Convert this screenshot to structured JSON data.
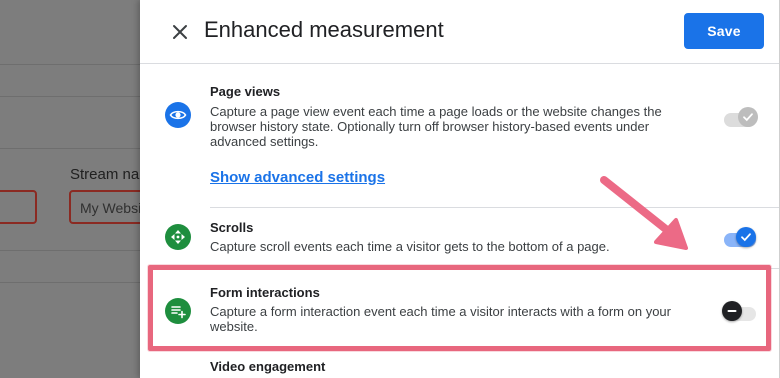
{
  "background_page": {
    "stream_name_label": "Stream nar",
    "stream_name_value": "My Websi"
  },
  "dialog": {
    "title": "Enhanced measurement",
    "save_label": "Save",
    "close_icon": "close-icon"
  },
  "settings": [
    {
      "title": "Page views",
      "description": "Capture a page view event each time a page loads or the website changes the browser history state. Optionally turn off browser history-based events under advanced settings.",
      "link": "Show advanced settings",
      "icon": "eye-icon",
      "icon_color": "#1a73e8",
      "toggle_state": "on-disabled"
    },
    {
      "title": "Scrolls",
      "description": "Capture scroll events each time a visitor gets to the bottom of a page.",
      "icon": "scroll-arrows-icon",
      "icon_color": "#1e8e3e",
      "toggle_state": "on"
    },
    {
      "title": "Form interactions",
      "description": "Capture a form interaction event each time a visitor interacts with a form on your website.",
      "icon": "form-add-icon",
      "icon_color": "#1e8e3e",
      "toggle_state": "off"
    },
    {
      "title": "Video engagement"
    }
  ],
  "colors": {
    "accent": "#1a73e8",
    "highlight": "#e8677e",
    "arrow": "#ec6a86"
  }
}
